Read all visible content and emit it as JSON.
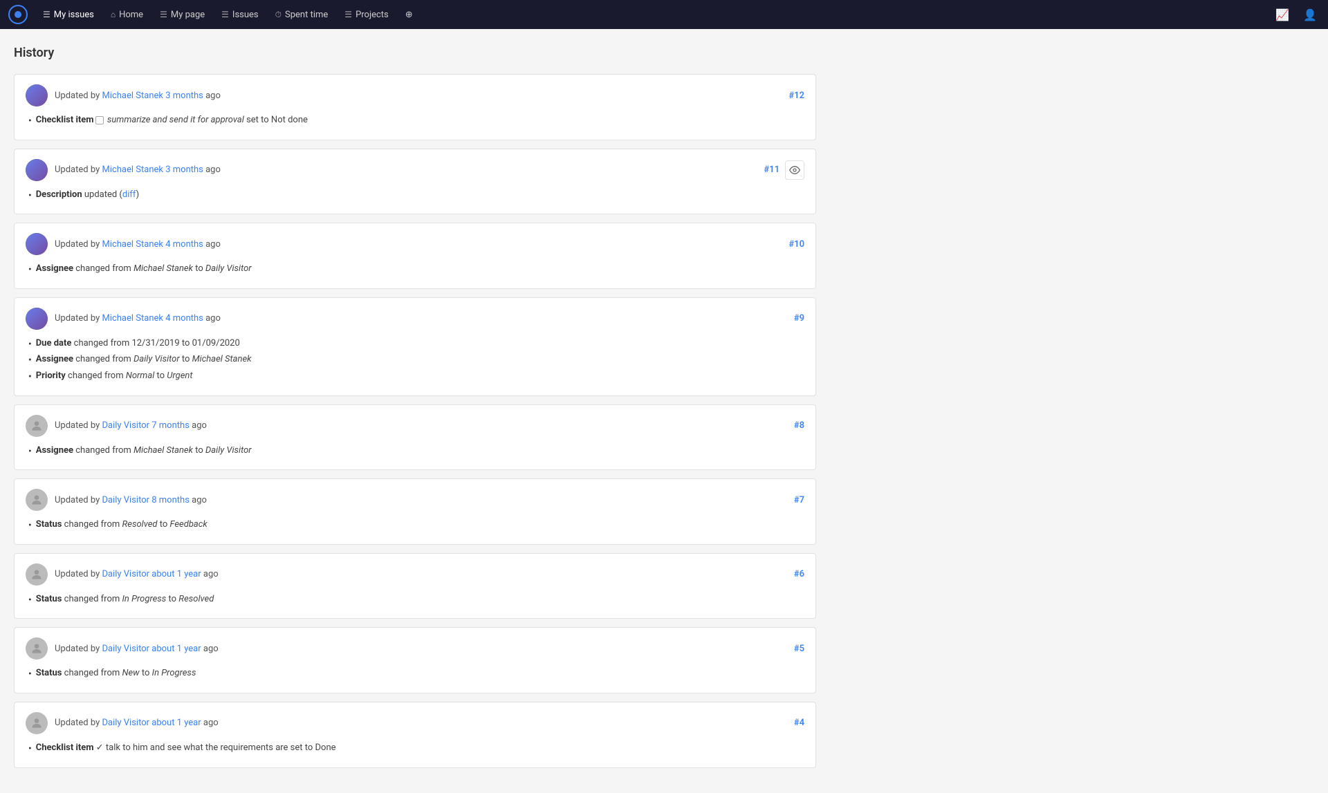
{
  "navbar": {
    "logo_label": "Logo",
    "items": [
      {
        "label": "My issues",
        "icon": "☰",
        "active": true
      },
      {
        "label": "Home",
        "icon": "⌂",
        "active": false
      },
      {
        "label": "My page",
        "icon": "☰",
        "active": false
      },
      {
        "label": "Issues",
        "icon": "☰",
        "active": false
      },
      {
        "label": "Spent time",
        "icon": "⏱",
        "active": false
      },
      {
        "label": "Projects",
        "icon": "☰",
        "active": false
      },
      {
        "label": "+",
        "icon": "",
        "active": false
      }
    ],
    "right_icons": [
      "chart-icon",
      "user-icon"
    ]
  },
  "page": {
    "title": "History"
  },
  "entries": [
    {
      "id": "#12",
      "avatar_type": "photo",
      "updated_by": "Michael Stanek",
      "time_ago": "3 months",
      "show_eye": false,
      "changes": [
        {
          "field": "Checklist item",
          "has_checkbox": true,
          "text": " summarize and send it for approval set to Not done"
        }
      ]
    },
    {
      "id": "#11",
      "avatar_type": "photo",
      "updated_by": "Michael Stanek",
      "time_ago": "3 months",
      "show_eye": true,
      "changes": [
        {
          "field": "Description",
          "text": " updated (",
          "link_text": "diff",
          "text_after": ")"
        }
      ]
    },
    {
      "id": "#10",
      "avatar_type": "photo",
      "updated_by": "Michael Stanek",
      "time_ago": "4 months",
      "show_eye": false,
      "changes": [
        {
          "field": "Assignee",
          "text": " changed from ",
          "italic_from": "Michael Stanek",
          "to_text": " to ",
          "italic_to": "Daily Visitor"
        }
      ]
    },
    {
      "id": "#9",
      "avatar_type": "photo",
      "updated_by": "Michael Stanek",
      "time_ago": "4 months",
      "show_eye": false,
      "changes": [
        {
          "field": "Due date",
          "text": " changed from 12/31/2019 to 01/09/2020"
        },
        {
          "field": "Assignee",
          "text": " changed from ",
          "italic_from": "Daily Visitor",
          "to_text": " to ",
          "italic_to": "Michael Stanek"
        },
        {
          "field": "Priority",
          "text": " changed from ",
          "italic_from": "Normal",
          "to_text": " to ",
          "italic_to": "Urgent"
        }
      ]
    },
    {
      "id": "#8",
      "avatar_type": "default",
      "updated_by": "Daily Visitor",
      "time_ago": "7 months",
      "show_eye": false,
      "changes": [
        {
          "field": "Assignee",
          "text": " changed from ",
          "italic_from": "Michael Stanek",
          "to_text": " to ",
          "italic_to": "Daily Visitor"
        }
      ]
    },
    {
      "id": "#7",
      "avatar_type": "default",
      "updated_by": "Daily Visitor",
      "time_ago": "8 months",
      "show_eye": false,
      "changes": [
        {
          "field": "Status",
          "text": " changed from ",
          "italic_from": "Resolved",
          "to_text": " to ",
          "italic_to": "Feedback"
        }
      ]
    },
    {
      "id": "#6",
      "avatar_type": "default",
      "updated_by": "Daily Visitor",
      "time_ago": "about 1 year",
      "show_eye": false,
      "changes": [
        {
          "field": "Status",
          "text": " changed from ",
          "italic_from": "In Progress",
          "to_text": " to ",
          "italic_to": "Resolved"
        }
      ]
    },
    {
      "id": "#5",
      "avatar_type": "default",
      "updated_by": "Daily Visitor",
      "time_ago": "about 1 year",
      "show_eye": false,
      "changes": [
        {
          "field": "Status",
          "text": " changed from ",
          "italic_from": "New",
          "to_text": " to ",
          "italic_to": "In Progress"
        }
      ]
    },
    {
      "id": "#4",
      "avatar_type": "default",
      "updated_by": "Daily Visitor",
      "time_ago": "about 1 year",
      "show_eye": false,
      "changes": [
        {
          "field": "Checklist item",
          "text": " ✓ talk to him and see what the requirements are set to Done"
        }
      ]
    }
  ]
}
